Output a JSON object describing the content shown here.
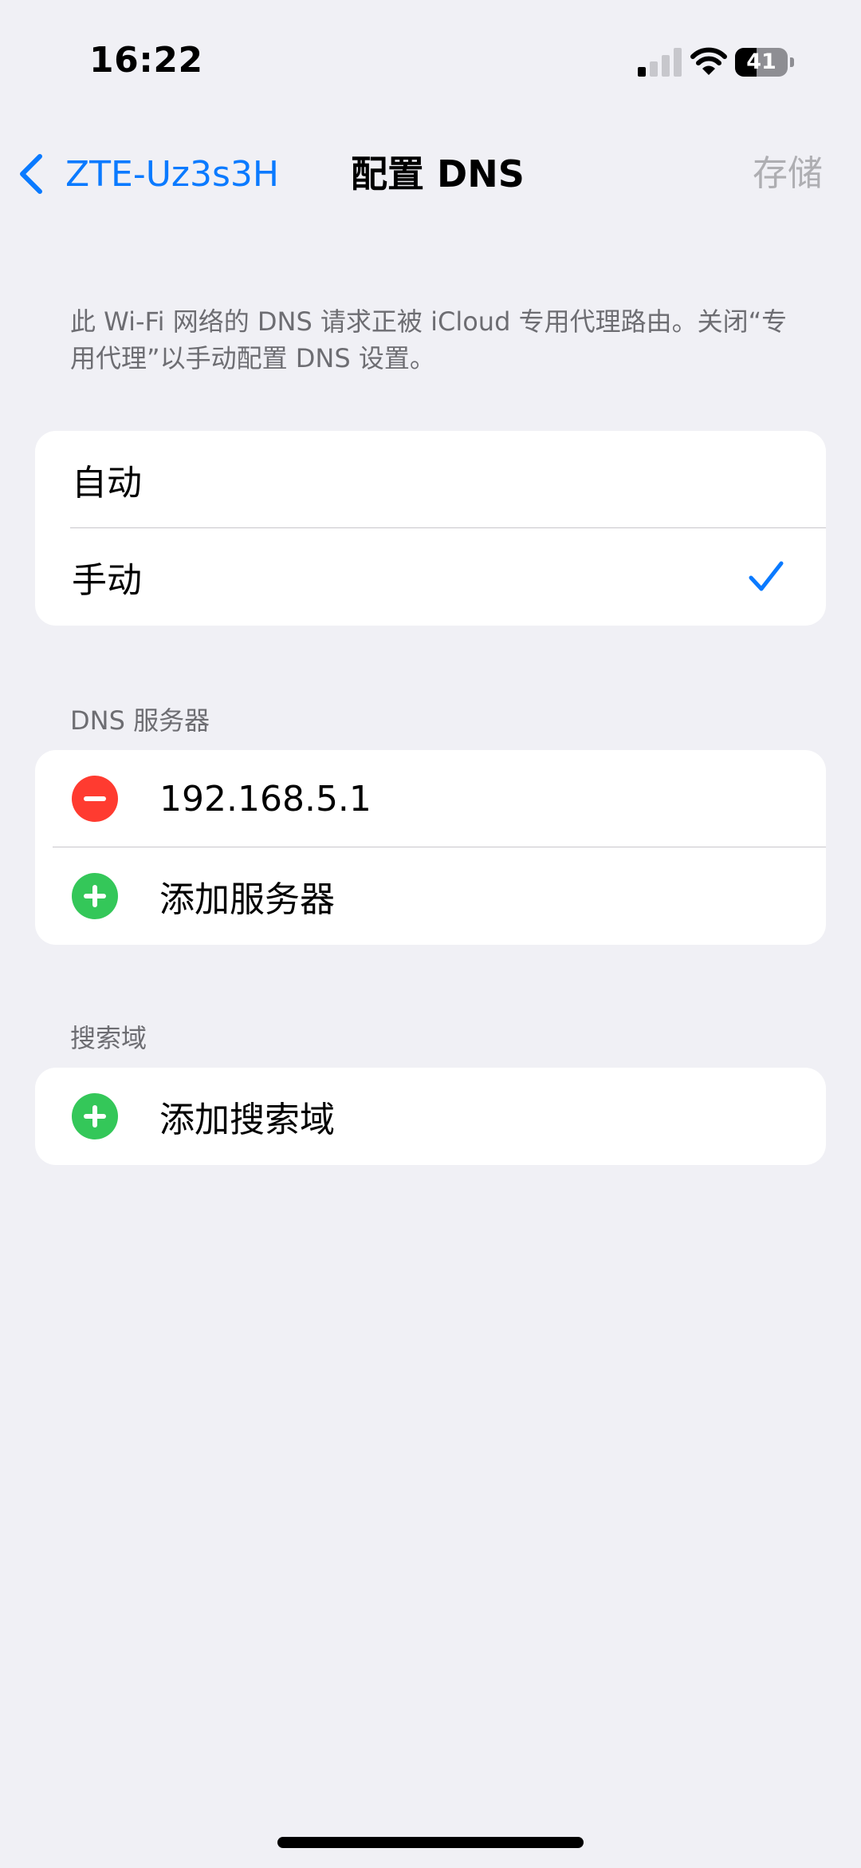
{
  "status_bar": {
    "time": "16:22",
    "battery_level": "41",
    "battery_fraction": 0.41,
    "signal_bars_active": 1,
    "signal_bars_total": 4
  },
  "nav": {
    "back_label": "ZTE-Uz3s3H",
    "title": "配置 DNS",
    "save_label": "存储"
  },
  "description": "此 Wi-Fi 网络的 DNS 请求正被 iCloud 专用代理路由。关闭“专用代理”以手动配置 DNS 设置。",
  "mode": {
    "options": [
      {
        "label": "自动",
        "selected": false
      },
      {
        "label": "手动",
        "selected": true
      }
    ]
  },
  "dns_servers": {
    "header": "DNS 服务器",
    "servers": [
      "192.168.5.1"
    ],
    "add_label": "添加服务器"
  },
  "search_domains": {
    "header": "搜索域",
    "add_label": "添加搜索域"
  },
  "colors": {
    "accent": "#0a7aff",
    "destructive": "#ff3b30",
    "add": "#34c759",
    "background": "#f0f0f5",
    "secondary_text": "#6d6d72"
  }
}
